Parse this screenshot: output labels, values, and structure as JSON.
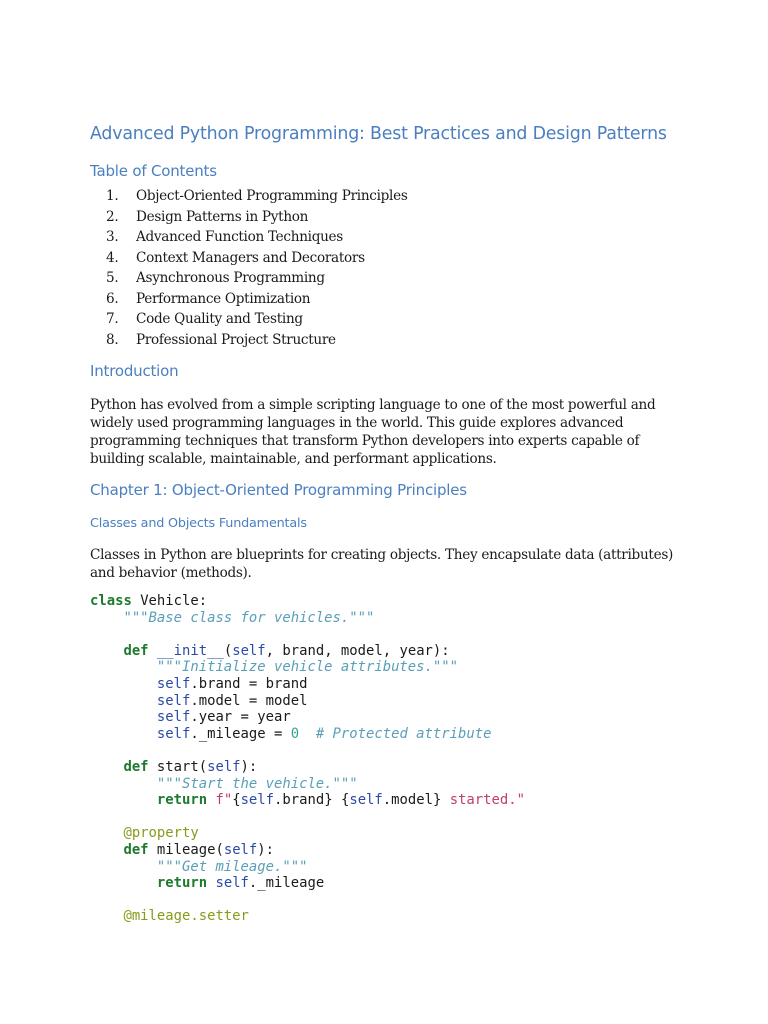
{
  "document": {
    "title": "Advanced Python Programming: Best Practices and Design Patterns",
    "toc_heading": "Table of Contents",
    "toc": [
      {
        "num": "1.",
        "text": "Object-Oriented Programming Principles"
      },
      {
        "num": "2.",
        "text": "Design Patterns in Python"
      },
      {
        "num": "3.",
        "text": "Advanced Function Techniques"
      },
      {
        "num": "4.",
        "text": "Context Managers and Decorators"
      },
      {
        "num": "5.",
        "text": "Asynchronous Programming"
      },
      {
        "num": "6.",
        "text": "Performance Optimization"
      },
      {
        "num": "7.",
        "text": "Code Quality and Testing"
      },
      {
        "num": "8.",
        "text": "Professional Project Structure"
      }
    ],
    "intro_heading": "Introduction",
    "intro_lines": [
      "Python has evolved from a simple scripting language to one of the most powerful and",
      "widely used programming languages in the world. This guide explores advanced",
      "programming techniques that transform Python developers into experts capable of",
      "building scalable, maintainable, and performant applications."
    ],
    "chapter1_heading": "Chapter 1: Object-Oriented Programming Principles",
    "section_heading": "Classes and Objects Fundamentals",
    "section_lines": [
      "Classes in Python are blueprints for creating objects. They encapsulate data (attributes)",
      "and behavior (methods)."
    ],
    "code": {
      "class_kw": "class",
      "class_decl": " Vehicle:",
      "class_doc": "\"\"\"Base class for vehicles.\"\"\"",
      "def_kw": "def",
      "init_name": "__init__",
      "init_open": "(",
      "self": "self",
      "init_params": ", brand, model, year):",
      "init_doc": "\"\"\"Initialize vehicle attributes.\"\"\"",
      "assign_brand": ".brand = brand",
      "assign_model": ".model = model",
      "assign_year": ".year = year",
      "assign_mileage": "._mileage = ",
      "zero": "0",
      "mileage_comment": "# Protected attribute",
      "start_sig": " start(",
      "close_colon": "):",
      "start_doc": "\"\"\"Start the vehicle.\"\"\"",
      "return_kw": "return",
      "fstring_prefix": " f\"",
      "brace_open": "{",
      "brand_attr": ".brand",
      "brace_close": "}",
      "space": " ",
      "model_attr": ".model",
      "started_str": " started.\"",
      "property_dec": "@property",
      "mileage_sig": " mileage(",
      "mileage_doc": "\"\"\"Get mileage.\"\"\"",
      "return_mileage": "._mileage",
      "setter_dec": "@mileage.setter"
    }
  }
}
